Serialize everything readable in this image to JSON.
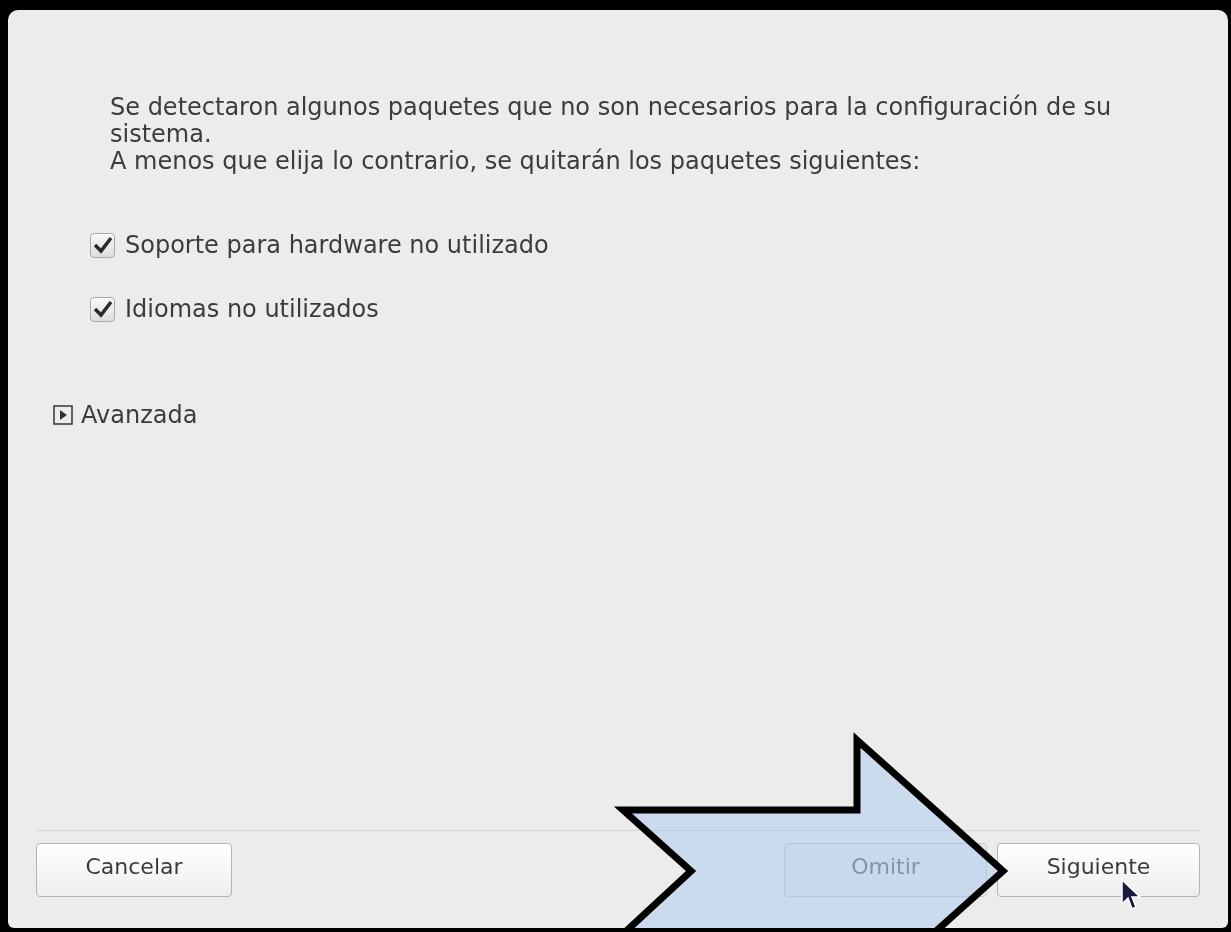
{
  "message": [
    "Se detectaron algunos paquetes que no son necesarios para la configuración de su sistema.",
    "A menos que elija lo contrario, se quitarán los paquetes siguientes:"
  ],
  "options": [
    {
      "label": "Soporte para hardware no utilizado",
      "checked": true
    },
    {
      "label": "Idiomas no utilizados",
      "checked": true
    }
  ],
  "advanced": {
    "label": "Avanzada",
    "expanded": false
  },
  "buttons": [
    {
      "label": "Cancelar",
      "kind": "left",
      "disabled": false
    },
    {
      "label": "Omitir",
      "kind": "right",
      "disabled": true
    },
    {
      "label": "Siguiente",
      "kind": "right",
      "disabled": false
    }
  ]
}
